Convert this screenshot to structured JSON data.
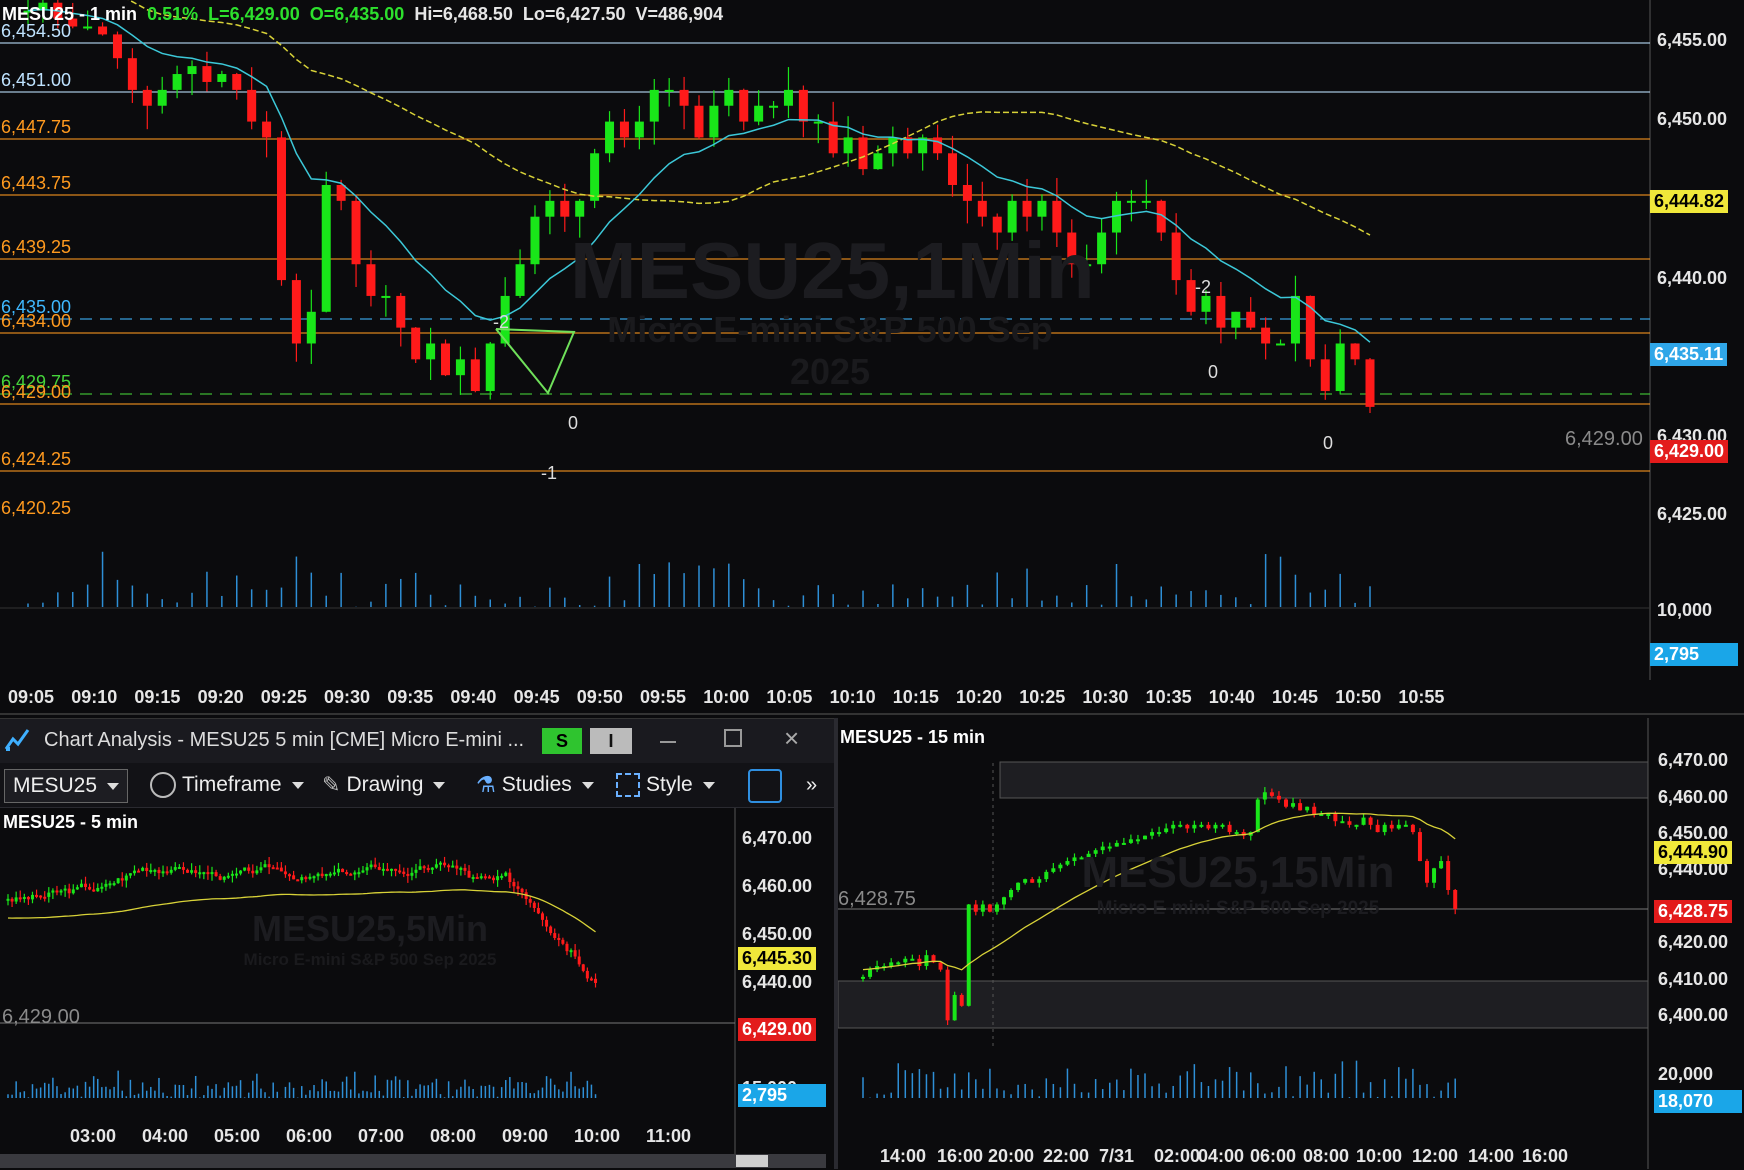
{
  "main_chart": {
    "header": {
      "symbol_tf": "MESU25 - 1 min",
      "change": "0.51%",
      "last": "L=6,429.00",
      "open": "O=6,435.00",
      "high": "Hi=6,468.50",
      "low": "Lo=6,427.50",
      "volume": "V=486,904"
    },
    "watermark": {
      "title": "MESU25,1Min",
      "subtitle": "Micro E-mini S&P 500 Sep 2025"
    },
    "level_labels": [
      {
        "text": "6,454.50",
        "color": "#bfe3ff"
      },
      {
        "text": "6,451.00",
        "color": "#bfe3ff"
      },
      {
        "text": "6,447.75",
        "color": "#ff9a1f"
      },
      {
        "text": "6,443.75",
        "color": "#ff9a1f"
      },
      {
        "text": "6,439.25",
        "color": "#ff9a1f"
      },
      {
        "text": "6,435.00",
        "color": "#3fb8ff"
      },
      {
        "text": "6,434.00",
        "color": "#ff9a1f"
      },
      {
        "text": "6,429.75",
        "color": "#45d43a"
      },
      {
        "text": "6,429.00",
        "color": "#ff9a1f"
      },
      {
        "text": "6,424.25",
        "color": "#ff9a1f"
      },
      {
        "text": "6,420.25",
        "color": "#ff9a1f"
      }
    ],
    "y_ticks": [
      "6,455.00",
      "6,450.00",
      "6,440.00",
      "6,430.00",
      "6,425.00"
    ],
    "tags": {
      "sma": "6,444.82",
      "ema": "6,435.11",
      "last": "6,429.00",
      "last_left": "6,429.00"
    },
    "volume_ticks": [
      "10,000"
    ],
    "volume_tag": "2,795",
    "x_ticks": [
      "09:05",
      "09:10",
      "09:15",
      "09:20",
      "09:25",
      "09:30",
      "09:35",
      "09:40",
      "09:45",
      "09:50",
      "09:55",
      "10:00",
      "10:05",
      "10:10",
      "10:15",
      "10:20",
      "10:25",
      "10:30",
      "10:35",
      "10:40",
      "10:45",
      "10:50",
      "10:55"
    ],
    "annotations": [
      "-2",
      "0",
      "-1",
      "-2",
      "0",
      "0"
    ]
  },
  "window_5min": {
    "title": "Chart Analysis - MESU25 5 min [CME] Micro E-mini ...",
    "s_button": "S",
    "i_button": "I",
    "symbol": "MESU25",
    "toolbar": {
      "timeframe": "Timeframe",
      "drawing": "Drawing",
      "studies": "Studies",
      "style": "Style"
    },
    "header": "MESU25 - 5 min",
    "watermark": {
      "title": "MESU25,5Min",
      "subtitle": "Micro E-mini S&P 500 Sep 2025"
    },
    "y_ticks": [
      "6,470.00",
      "6,460.00",
      "6,450.00",
      "6,440.00"
    ],
    "tags": {
      "ma": "6,445.30",
      "last": "6,429.00",
      "volume": "2,795"
    },
    "last_left": "6,429.00",
    "vol_tick": "15,000",
    "x_ticks": [
      "03:00",
      "04:00",
      "05:00",
      "06:00",
      "07:00",
      "08:00",
      "09:00",
      "10:00",
      "11:00"
    ]
  },
  "chart_15min": {
    "header": "MESU25 - 15 min",
    "watermark": {
      "title": "MESU25,15Min",
      "subtitle": "Micro E-mini S&P 500 Sep 2025"
    },
    "y_ticks": [
      "6,470.00",
      "6,460.00",
      "6,450.00",
      "6,440.00",
      "6,420.00",
      "6,410.00",
      "6,400.00"
    ],
    "tags": {
      "ma": "6,444.90",
      "last": "6,428.75",
      "volume": "18,070"
    },
    "last_left": "6,428.75",
    "vol_tick": "20,000",
    "x_ticks": [
      "14:00",
      "16:00",
      "20:00",
      "22:00",
      "7/31",
      "02:00",
      "04:00",
      "06:00",
      "08:00",
      "10:00",
      "12:00",
      "14:00",
      "16:00"
    ]
  },
  "colors": {
    "up": "#19e619",
    "down": "#ff1a1a",
    "ma_cyan": "#3cc8d8",
    "ma_yellow": "#d8d238",
    "orange": "#ff9a1f",
    "volume": "#2e8fd6"
  }
}
